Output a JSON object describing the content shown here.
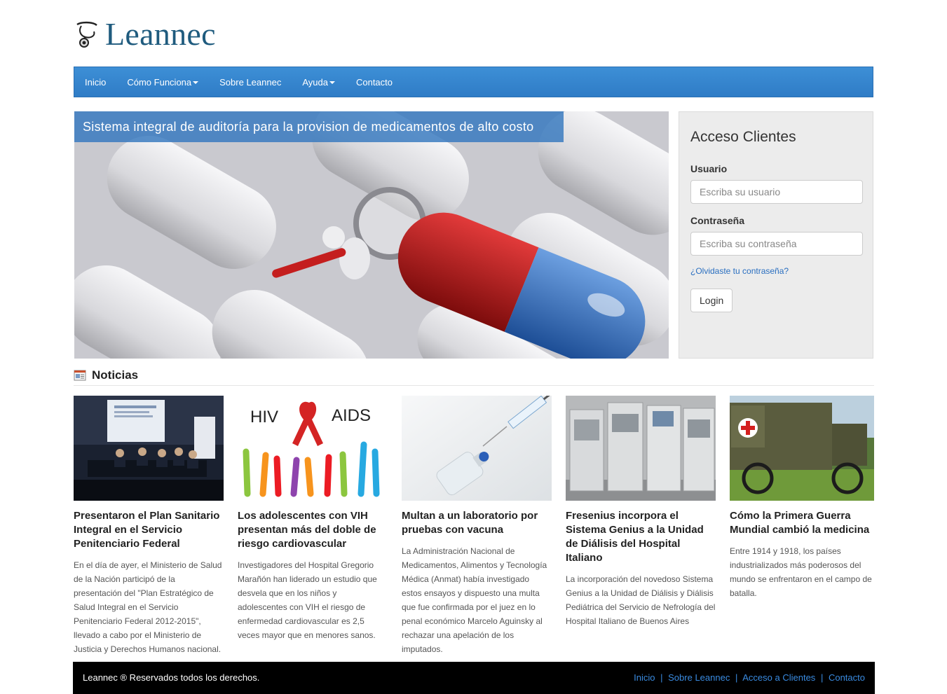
{
  "brand": {
    "name": "Leannec",
    "color": "#1f5b7e"
  },
  "nav": {
    "items": [
      {
        "label": "Inicio",
        "dropdown": false
      },
      {
        "label": "Cómo Funciona",
        "dropdown": true
      },
      {
        "label": "Sobre Leannec",
        "dropdown": false
      },
      {
        "label": "Ayuda",
        "dropdown": true
      },
      {
        "label": "Contacto",
        "dropdown": false
      }
    ],
    "color": "#337ab7"
  },
  "hero": {
    "caption": "Sistema integral de auditoría para la provision de medicamentos de alto costo"
  },
  "login": {
    "title": "Acceso Clientes",
    "user_label": "Usuario",
    "user_placeholder": "Escriba su usuario",
    "pass_label": "Contraseña",
    "pass_placeholder": "Escriba su contraseña",
    "forgot": "¿Olvidaste tu contraseña?",
    "button": "Login"
  },
  "news": {
    "title": "Noticias",
    "items": [
      {
        "title": "Presentaron el Plan Sanitario Integral en el Servicio Penitenciario Federal",
        "body": "En el día de ayer, el Ministerio de Salud de la Nación participó de la presentación del \"Plan Estratégico de Salud Integral en el Servicio Penitenciario Federal 2012-2015\", llevado a cabo por el Ministerio de Justicia y Derechos Humanos nacional."
      },
      {
        "title": "Los adolescentes con VIH presentan más del doble de riesgo cardiovascular",
        "body": "Investigadores del Hospital Gregorio Marañón han liderado un estudio que desvela que en los niños y adolescentes con VIH el riesgo de enfermedad cardiovascular es 2,5 veces mayor que en menores sanos.",
        "image_text": [
          "HIV",
          "AIDS"
        ]
      },
      {
        "title": "Multan a un laboratorio por pruebas con vacuna",
        "body": "La Administración Nacional de Medicamentos, Alimentos y Tecnología Médica (Anmat) había investigado estos ensayos y dispuesto una multa que fue confirmada por el juez en lo penal económico Marcelo Aguinsky al rechazar una apelación de los imputados."
      },
      {
        "title": "Fresenius incorpora el Sistema Genius a la Unidad de Diálisis del Hospital Italiano",
        "body": "La incorporación del novedoso Sistema Genius a la Unidad de Diálisis y Diálisis Pediátrica del Servicio de Nefrología del Hospital Italiano de Buenos Aires"
      },
      {
        "title": "Cómo la Primera Guerra Mundial cambió la medicina",
        "body": "Entre 1914 y 1918, los países industrializados más poderosos del mundo se enfrentaron en el campo de batalla."
      }
    ]
  },
  "footer": {
    "copyright": "Leannec ® Reservados todos los derechos.",
    "links": [
      "Inicio",
      "Sobre Leannec",
      "Acceso a Clientes",
      "Contacto"
    ],
    "separator": "|"
  }
}
